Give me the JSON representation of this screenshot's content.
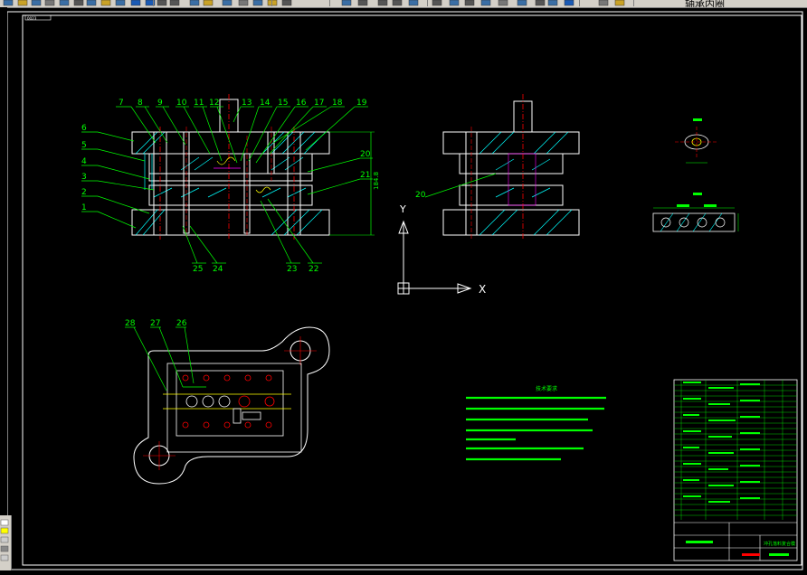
{
  "toolbar": {
    "layer_name": "轴承内圈",
    "buttons": [
      "new-file-icon",
      "open-icon",
      "save-icon",
      "print-icon",
      "preview-icon",
      "cut-icon",
      "copy-icon",
      "paste-icon",
      "match-icon",
      "undo-icon",
      "redo-icon",
      "pan-icon",
      "zoom-realtime-icon",
      "zoom-window-icon",
      "zoom-previous-icon",
      "properties-icon",
      "design-center-icon",
      "tool-palette-icon",
      "calc-icon",
      "help-icon",
      "layers-icon",
      "layer-state-icon"
    ]
  },
  "drawing": {
    "title_block_tag": "0023",
    "part_labels_top": [
      "7",
      "8",
      "9",
      "10",
      "11",
      "12",
      "13",
      "14",
      "15",
      "16",
      "17",
      "18",
      "19"
    ],
    "part_labels_left": [
      "6",
      "5",
      "4",
      "3",
      "2",
      "1"
    ],
    "part_labels_bottom": [
      "25",
      "24",
      "23",
      "22"
    ],
    "part_labels_right": [
      "20",
      "21"
    ],
    "side_view_label": "20",
    "plan_labels": [
      "28",
      "27",
      "26"
    ],
    "dimension_text": "184.8",
    "ucs": {
      "y_label": "Y",
      "x_label": "X"
    },
    "notes_title": "技术要求",
    "title_block_name": "冲孔落料复合模",
    "colors": {
      "background": "#000000",
      "outline": "#ffffff",
      "hatch": "#00ffff",
      "dimension": "#00ff00",
      "center": "#ff0000",
      "hidden": "#ffff00",
      "magenta": "#ff00ff"
    }
  }
}
